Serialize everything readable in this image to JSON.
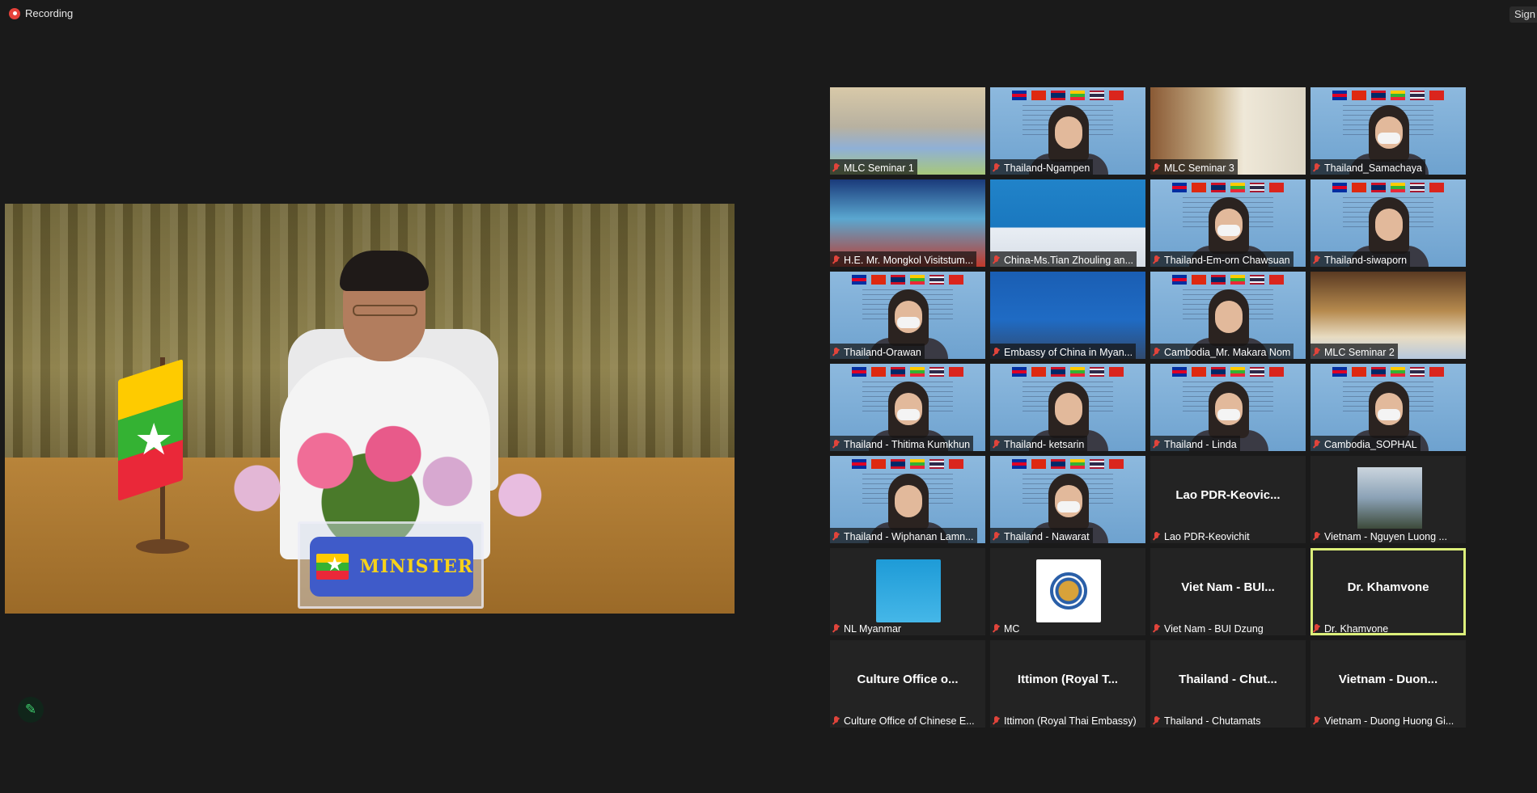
{
  "recording": {
    "label": "Recording"
  },
  "top_right": {
    "label": "Sign i"
  },
  "speaker": {
    "plaque_text": "MINISTER"
  },
  "participants": [
    {
      "name": "MLC Seminar 1",
      "display": "video",
      "style": "room"
    },
    {
      "name": "Thailand-Ngampen",
      "display": "video",
      "style": "blue"
    },
    {
      "name": "MLC Seminar 3",
      "display": "video",
      "style": "room2"
    },
    {
      "name": "Thailand_Samachaya",
      "display": "video",
      "style": "blue"
    },
    {
      "name": "H.E. Mr. Mongkol Visitstum...",
      "display": "video",
      "style": "stage"
    },
    {
      "name": "China-Ms.Tian Zhouling an...",
      "display": "video",
      "style": "lib"
    },
    {
      "name": "Thailand-Em-orn Chawsuan",
      "display": "video",
      "style": "blue"
    },
    {
      "name": "Thailand-siwaporn",
      "display": "video",
      "style": "blue"
    },
    {
      "name": "Thailand-Orawan",
      "display": "video",
      "style": "blue"
    },
    {
      "name": "Embassy of China in Myan...",
      "display": "video",
      "style": "emb"
    },
    {
      "name": "Cambodia_Mr. Makara Nom",
      "display": "video",
      "style": "blue"
    },
    {
      "name": "MLC Seminar 2",
      "display": "video",
      "style": "hall"
    },
    {
      "name": "Thailand - Thitima Kumkhun",
      "display": "video",
      "style": "blue"
    },
    {
      "name": "Thailand- ketsarin",
      "display": "video",
      "style": "blue"
    },
    {
      "name": "Thailand - Linda",
      "display": "video",
      "style": "blue"
    },
    {
      "name": "Cambodia_SOPHAL",
      "display": "video",
      "style": "blue"
    },
    {
      "name": "Thailand - Wiphanan Lamn...",
      "display": "video",
      "style": "blue"
    },
    {
      "name": "Thailand - Nawarat",
      "display": "video",
      "style": "blue"
    },
    {
      "name": "Lao PDR-Keovichit",
      "display": "text",
      "center": "Lao  PDR-Keovic..."
    },
    {
      "name": "Vietnam - Nguyen Luong ...",
      "display": "photo"
    },
    {
      "name": "NL Myanmar",
      "display": "poster"
    },
    {
      "name": "MC",
      "display": "logo"
    },
    {
      "name": "Viet Nam - BUI Dzung",
      "display": "text",
      "center": "Viet Nam - BUI..."
    },
    {
      "name": "Dr. Khamvone",
      "display": "text",
      "center": "Dr. Khamvone",
      "active": true
    },
    {
      "name": "Culture Office of Chinese E...",
      "display": "text",
      "center": "Culture Office o..."
    },
    {
      "name": "Ittimon (Royal Thai Embassy)",
      "display": "text",
      "center": "Ittimon (Royal T..."
    },
    {
      "name": "Thailand - Chutamats",
      "display": "text",
      "center": "Thailand - Chut..."
    },
    {
      "name": "Vietnam - Duong Huong Gi...",
      "display": "text",
      "center": "Vietnam - Duon..."
    }
  ],
  "icons": {
    "recording": "record-dot-icon",
    "muted": "muted-mic-icon",
    "annotate": "pencil-icon"
  },
  "colors": {
    "background": "#1a1a1a",
    "active_speaker_border": "#dcef7a",
    "muted_icon": "#e0443b",
    "annotate_icon": "#3fcf6e"
  }
}
